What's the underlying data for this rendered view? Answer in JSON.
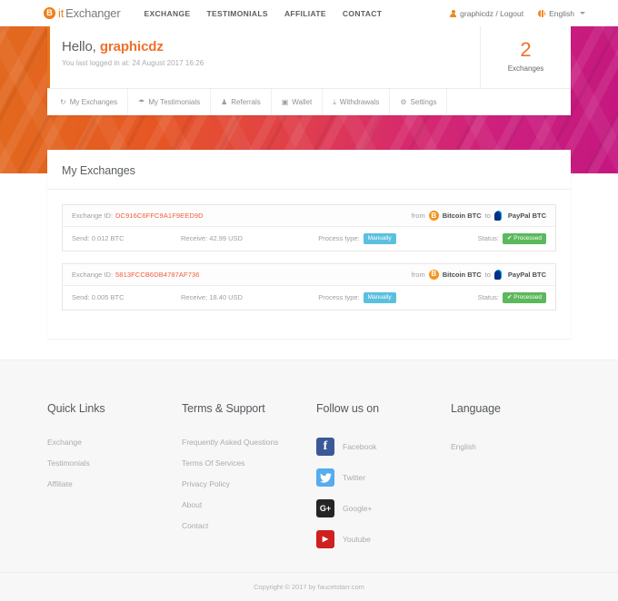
{
  "brand": {
    "mark_letter": "B",
    "name_part1": "it",
    "name_part2": "Exchanger",
    "accent": "#f0861e"
  },
  "navbar": {
    "links": [
      {
        "label": "EXCHANGE"
      },
      {
        "label": "TESTIMONIALS"
      },
      {
        "label": "AFFILIATE"
      },
      {
        "label": "CONTACT"
      }
    ],
    "user_label": "graphicdz / Logout",
    "language_label": "English"
  },
  "user_card": {
    "greeting_prefix": "Hello, ",
    "username": "graphicdz",
    "last_login": "You last logged in at: 24 August 2017 16:26",
    "exchanges_count": "2",
    "exchanges_label": "Exchanges",
    "tabs": [
      {
        "label": "My Exchanges",
        "icon": "refresh-icon",
        "glyph": "↻"
      },
      {
        "label": "My Testimonials",
        "icon": "comment-icon",
        "glyph": "☂"
      },
      {
        "label": "Referrals",
        "icon": "users-icon",
        "glyph": "♟"
      },
      {
        "label": "Wallet",
        "icon": "wallet-icon",
        "glyph": "▣"
      },
      {
        "label": "Withdrawals",
        "icon": "download-icon",
        "glyph": "⤓"
      },
      {
        "label": "Settings",
        "icon": "gear-icon",
        "glyph": "⚙"
      }
    ]
  },
  "main": {
    "title": "My Exchanges",
    "labels": {
      "exchange_id": "Exchange ID:",
      "from": "from",
      "to": "to",
      "send": "Send:",
      "receive": "Receive:",
      "process_type": "Process type:",
      "status": "Status:"
    },
    "exchanges": [
      {
        "id": "DC916C6FFC9A1F9EED9D",
        "from": "Bitcoin BTC",
        "to": "PayPal BTC",
        "send": "0.012 BTC",
        "receive": "42.99 USD",
        "process_type": "Manually",
        "status": "Processed",
        "status_glyph": "✔"
      },
      {
        "id": "5813FCCB6DB4787AF736",
        "from": "Bitcoin BTC",
        "to": "PayPal BTC",
        "send": "0.005 BTC",
        "receive": "18.40 USD",
        "process_type": "Manually",
        "status": "Processed",
        "status_glyph": "✔"
      }
    ]
  },
  "footer": {
    "col1": {
      "title": "Quick Links",
      "links": [
        {
          "label": "Exchange"
        },
        {
          "label": "Testimonials"
        },
        {
          "label": "Affiliate"
        }
      ]
    },
    "col2": {
      "title": "Terms & Support",
      "links": [
        {
          "label": "Frequently Asked Questions"
        },
        {
          "label": "Terms Of Services"
        },
        {
          "label": "Privacy Policy"
        },
        {
          "label": "About"
        },
        {
          "label": "Contact"
        }
      ]
    },
    "col3": {
      "title": "Follow us on",
      "socials": [
        {
          "label": "Facebook",
          "glyph": "f",
          "color": "#3b5998"
        },
        {
          "label": "Twitter",
          "glyph": "ᴠ",
          "color": "#55acee"
        },
        {
          "label": "Google+",
          "glyph": "G+",
          "color": "#252525"
        },
        {
          "label": "Youtube",
          "glyph": "▶",
          "color": "#cd201f"
        }
      ]
    },
    "col4": {
      "title": "Language",
      "value": "English"
    },
    "copyright": "Copyright © 2017 by faucetstarr.com"
  }
}
